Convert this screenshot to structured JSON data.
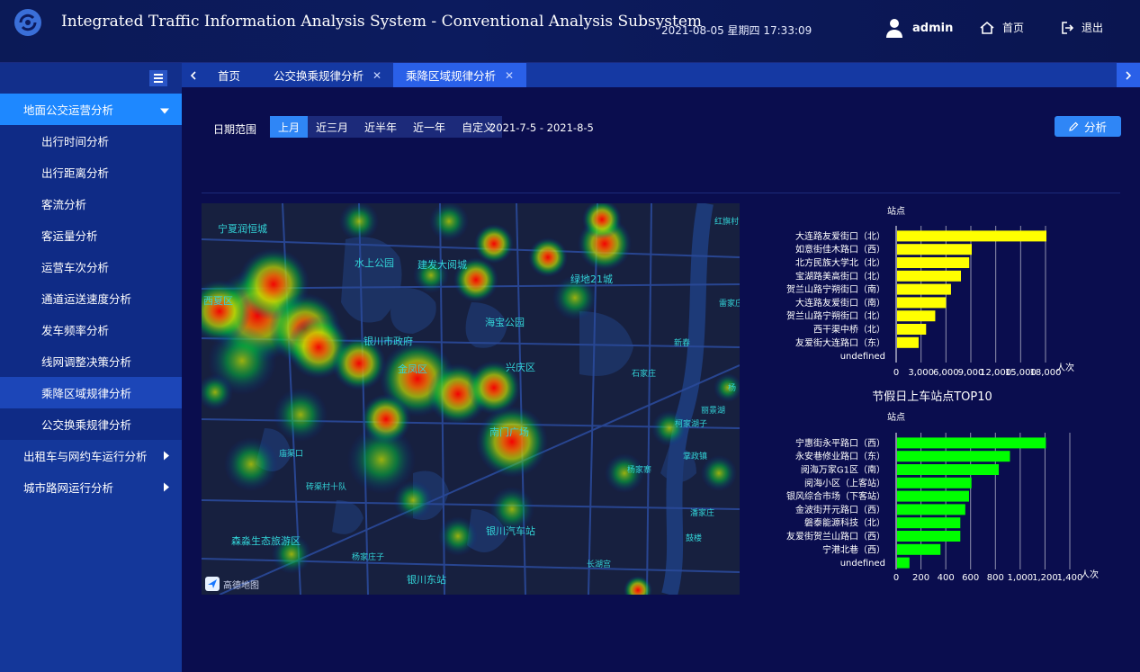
{
  "header": {
    "title": "Integrated Traffic Information Analysis System - Conventional Analysis Subsystem",
    "datetime": "2021-08-05  星期四  17:33:09",
    "user": "admin",
    "home_label": "首页",
    "exit_label": "退出"
  },
  "sidebar": {
    "groups": [
      {
        "label": "地面公交运营分析",
        "expanded": true,
        "items": [
          {
            "label": "出行时间分析"
          },
          {
            "label": "出行距离分析"
          },
          {
            "label": "客流分析"
          },
          {
            "label": "客运量分析"
          },
          {
            "label": "运营车次分析"
          },
          {
            "label": "通道运送速度分析"
          },
          {
            "label": "发车频率分析"
          },
          {
            "label": "线网调整决策分析"
          },
          {
            "label": "乘降区域规律分析"
          },
          {
            "label": "公交换乘规律分析"
          }
        ]
      },
      {
        "label": "出租车与网约车运行分析",
        "expanded": false
      },
      {
        "label": "城市路网运行分析",
        "expanded": false
      }
    ],
    "selected": "乘降区域规律分析"
  },
  "tabs": [
    {
      "label": "首页",
      "closable": false,
      "active": false
    },
    {
      "label": "公交换乘规律分析",
      "closable": true,
      "active": false
    },
    {
      "label": "乘降区域规律分析",
      "closable": true,
      "active": true
    }
  ],
  "filter": {
    "label": "日期范围",
    "options": [
      "上月",
      "近三月",
      "近半年",
      "近一年",
      "自定义"
    ],
    "selected": "上月",
    "range": "2021-7-5 - 2021-8-5",
    "analyze_label": "分析"
  },
  "map": {
    "labels": [
      "宁夏润恒城",
      "水上公园",
      "建发大阅城",
      "绿地21城",
      "西夏区",
      "海宝公园",
      "银川市政府",
      "金凤区",
      "兴庆区",
      "新春",
      "石家庄",
      "丽景湖",
      "柯家湖子",
      "鼓楼",
      "南门广场",
      "庙渠口",
      "掌政镇",
      "杨家寨",
      "砖渠村十队",
      "潘家庄",
      "森淼生态旅游区",
      "银川汽车站",
      "长湖宫",
      "杨家庄子",
      "银川东站",
      "红旗村",
      "雷家庄",
      "杨"
    ],
    "attribution": "高德地图"
  },
  "chart_data": [
    {
      "type": "bar",
      "orientation": "horizontal",
      "title": "",
      "ylabel": "站点",
      "xlabel": "人次",
      "categories": [
        "大连路友爱街口（北）",
        "如意街佳木路口（西）",
        "北方民族大学北（北）",
        "宝湖路美高街口（北）",
        "贺兰山路宁朔街口（南）",
        "大连路友爱街口（南）",
        "贺兰山路宁朔街口（北）",
        "西干渠中桥（北）",
        "友爱街大连路口（东）",
        "undefined"
      ],
      "values": [
        18000,
        9000,
        8700,
        7700,
        6500,
        5900,
        4600,
        3500,
        2600,
        0
      ],
      "xlim": [
        0,
        18000
      ],
      "xticks": [
        "0",
        "3,000",
        "6,000",
        "9,000",
        "12,000",
        "15,000",
        "18,000"
      ],
      "color": "#ffff00",
      "grid": true
    },
    {
      "type": "bar",
      "orientation": "horizontal",
      "title": "节假日上车站点TOP10",
      "ylabel": "站点",
      "xlabel": "人次",
      "categories": [
        "宁惠街永平路口（西）",
        "永安巷修业路口（东）",
        "阅海万家G1区（南）",
        "阅海小区（上客站）",
        "银风综合市场（下客站）",
        "金波街开元路口（西）",
        "磐泰能源科技（北）",
        "友爱街贺兰山路口（西）",
        "宁港北巷（西）",
        "undefined"
      ],
      "values": [
        1200,
        910,
        820,
        600,
        580,
        550,
        510,
        510,
        350,
        100
      ],
      "xlim": [
        0,
        1400
      ],
      "xticks": [
        "0",
        "200",
        "400",
        "600",
        "800",
        "1,000",
        "1,200",
        "1,400"
      ],
      "color": "#00ff00",
      "grid": true
    }
  ],
  "colors": {
    "accent": "#2f86f6",
    "sidebar": "#14379a",
    "background": "#0a0d4e",
    "bar1": "#ffff00",
    "bar2": "#00ff00"
  }
}
